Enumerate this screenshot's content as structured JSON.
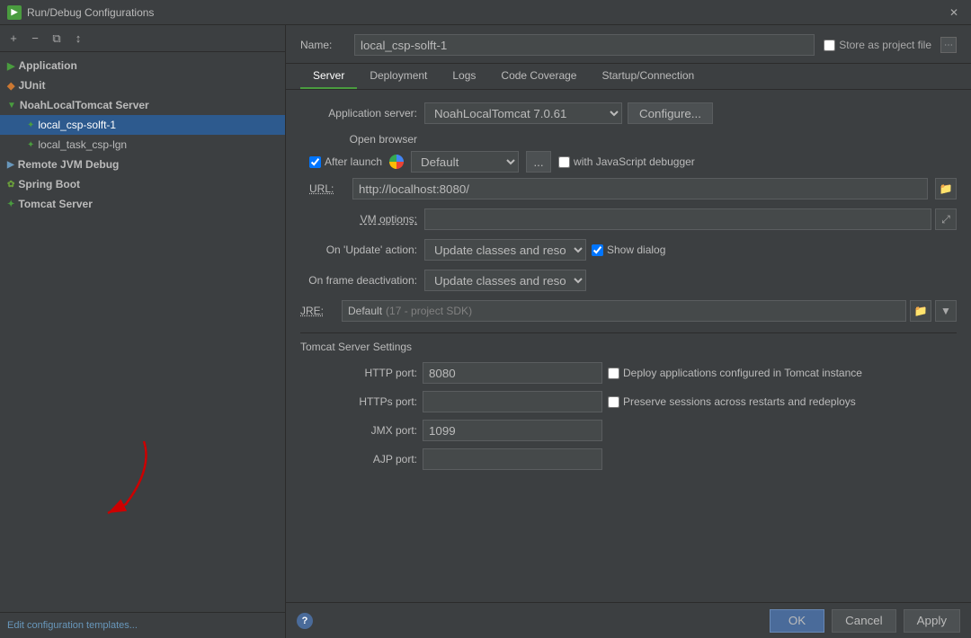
{
  "window": {
    "title": "Run/Debug Configurations",
    "close_label": "✕"
  },
  "toolbar": {
    "add_btn": "+",
    "remove_btn": "−",
    "copy_btn": "⧉",
    "sort_btn": "↕"
  },
  "tree": {
    "groups": [
      {
        "id": "application",
        "label": "Application",
        "icon": "app-icon",
        "items": []
      },
      {
        "id": "junit",
        "label": "JUnit",
        "icon": "junit-icon",
        "items": []
      },
      {
        "id": "noahlocaltomcat",
        "label": "NoahLocalTomcat Server",
        "icon": "tomcat-icon",
        "items": [
          {
            "id": "local_csp_solft_1",
            "label": "local_csp-solft-1",
            "selected": true
          },
          {
            "id": "local_task_csp_lgn",
            "label": "local_task_csp-lgn",
            "selected": false
          }
        ]
      },
      {
        "id": "remote_jvm",
        "label": "Remote JVM Debug",
        "icon": "remote-icon",
        "items": []
      },
      {
        "id": "spring_boot",
        "label": "Spring Boot",
        "icon": "spring-icon",
        "items": []
      },
      {
        "id": "tomcat_server",
        "label": "Tomcat Server",
        "icon": "tomcat2-icon",
        "items": []
      }
    ],
    "footer_link": "Edit configuration templates..."
  },
  "header": {
    "name_label": "Name:",
    "name_value": "local_csp-solft-1",
    "store_label": "Store as project file"
  },
  "tabs": [
    {
      "id": "server",
      "label": "Server",
      "active": true
    },
    {
      "id": "deployment",
      "label": "Deployment",
      "active": false
    },
    {
      "id": "logs",
      "label": "Logs",
      "active": false
    },
    {
      "id": "code_coverage",
      "label": "Code Coverage",
      "active": false
    },
    {
      "id": "startup_connection",
      "label": "Startup/Connection",
      "active": false
    }
  ],
  "server_tab": {
    "app_server_label": "Application server:",
    "app_server_value": "NoahLocalTomcat 7.0.61",
    "configure_btn": "Configure...",
    "open_browser_label": "Open browser",
    "after_launch_label": "After launch",
    "after_launch_checked": true,
    "browser_value": "Default",
    "dots_btn": "...",
    "with_js_debugger_label": "with JavaScript debugger",
    "with_js_debugger_checked": false,
    "url_label": "URL:",
    "url_value": "http://localhost:8080/",
    "vm_options_label": "VM options:",
    "vm_options_value": "",
    "on_update_label": "On 'Update' action:",
    "on_update_value": "Update classes and resources",
    "show_dialog_label": "Show dialog",
    "show_dialog_checked": true,
    "on_frame_label": "On frame deactivation:",
    "on_frame_value": "Update classes and resources",
    "jre_label": "JRE:",
    "jre_default": "Default",
    "jre_sdk": "(17 - project SDK)",
    "tomcat_section": "Tomcat Server Settings",
    "http_port_label": "HTTP port:",
    "http_port_value": "8080",
    "https_port_label": "HTTPs port:",
    "https_port_value": "",
    "jmx_port_label": "JMX port:",
    "jmx_port_value": "1099",
    "ajp_port_label": "AJP port:",
    "ajp_port_value": "",
    "deploy_apps_label": "Deploy applications configured in Tomcat instance",
    "deploy_apps_checked": false,
    "preserve_sessions_label": "Preserve sessions across restarts and redeploys",
    "preserve_sessions_checked": false
  },
  "bottom": {
    "ok_label": "OK",
    "cancel_label": "Cancel",
    "apply_label": "Apply"
  }
}
